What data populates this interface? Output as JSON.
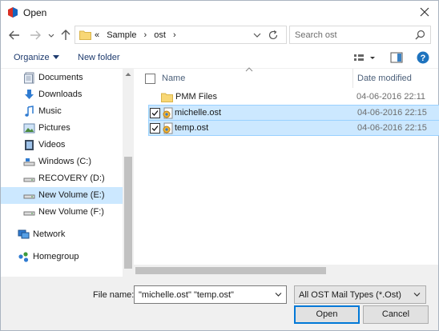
{
  "window": {
    "title": "Open",
    "accent": "#0078d7"
  },
  "nav": {
    "breadcrumb": [
      "«",
      "Sample",
      "›",
      "ost",
      "›"
    ],
    "search_placeholder": "Search ost",
    "icons": [
      "back-arrow-icon",
      "forward-arrow-icon",
      "chevron-down-icon",
      "up-arrow-icon",
      "refresh-icon",
      "search-icon"
    ]
  },
  "toolbar": {
    "organize_label": "Organize",
    "new_folder_label": "New folder"
  },
  "sidebar": {
    "items": [
      {
        "label": "Documents",
        "icon": "documents-icon"
      },
      {
        "label": "Downloads",
        "icon": "downloads-icon"
      },
      {
        "label": "Music",
        "icon": "music-icon"
      },
      {
        "label": "Pictures",
        "icon": "pictures-icon"
      },
      {
        "label": "Videos",
        "icon": "videos-icon"
      },
      {
        "label": "Windows (C:)",
        "icon": "drive-icon"
      },
      {
        "label": "RECOVERY (D:)",
        "icon": "drive-icon"
      },
      {
        "label": "New Volume (E:)",
        "icon": "drive-icon",
        "selected": true
      },
      {
        "label": "New Volume (F:)",
        "icon": "drive-icon"
      },
      {
        "label": "Network",
        "icon": "network-icon"
      },
      {
        "label": "Homegroup",
        "icon": "homegroup-icon"
      }
    ]
  },
  "files": {
    "columns": {
      "name": "Name",
      "date": "Date modified"
    },
    "rows": [
      {
        "name": "PMM Files",
        "date": "04-06-2016 22:11",
        "type": "folder",
        "selected": false
      },
      {
        "name": "michelle.ost",
        "date": "04-06-2016 22:15",
        "type": "ost",
        "selected": true
      },
      {
        "name": "temp.ost",
        "date": "04-06-2016 22:15",
        "type": "ost",
        "selected": true
      }
    ]
  },
  "footer": {
    "file_name_label": "File name:",
    "file_name_value": "\"michelle.ost\" \"temp.ost\"",
    "file_type_value": "All OST Mail Types (*.Ost)",
    "open_label": "Open",
    "cancel_label": "Cancel"
  }
}
